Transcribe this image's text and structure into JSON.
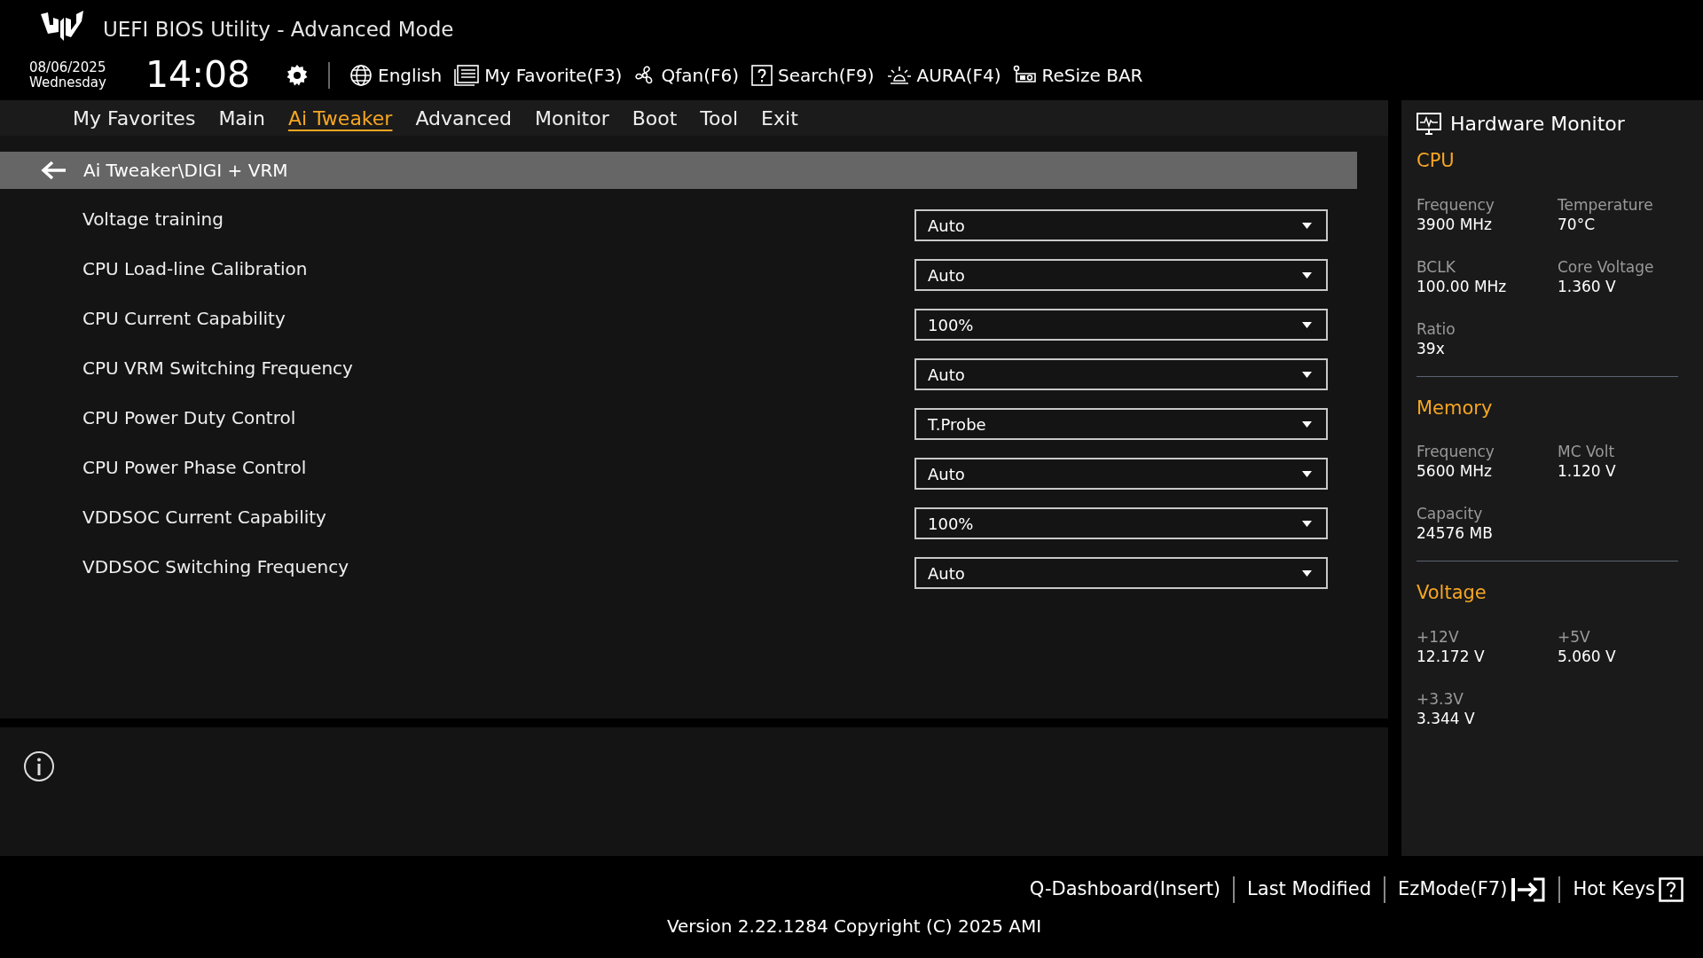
{
  "header": {
    "title": "UEFI BIOS Utility - Advanced Mode",
    "date": "08/06/2025",
    "weekday": "Wednesday",
    "time": "14:08",
    "toolbar": [
      {
        "kind": "settings"
      },
      {
        "kind": "language",
        "label": "English"
      },
      {
        "kind": "favorite",
        "label": "My Favorite(F3)"
      },
      {
        "kind": "fan",
        "label": "Qfan(F6)"
      },
      {
        "kind": "search",
        "label": "Search(F9)"
      },
      {
        "kind": "aura",
        "label": "AURA(F4)"
      },
      {
        "kind": "resize",
        "label": "ReSize BAR"
      }
    ]
  },
  "tabs": [
    {
      "label": "My Favorites",
      "selected": false
    },
    {
      "label": "Main",
      "selected": false
    },
    {
      "label": "Ai Tweaker",
      "selected": true
    },
    {
      "label": "Advanced",
      "selected": false
    },
    {
      "label": "Monitor",
      "selected": false
    },
    {
      "label": "Boot",
      "selected": false
    },
    {
      "label": "Tool",
      "selected": false
    },
    {
      "label": "Exit",
      "selected": false
    }
  ],
  "breadcrumb": "Ai Tweaker\\DIGI + VRM",
  "settings": [
    {
      "label": "Voltage training",
      "value": "Auto"
    },
    {
      "label": "CPU Load-line Calibration",
      "value": "Auto"
    },
    {
      "label": "CPU Current Capability",
      "value": "100%"
    },
    {
      "label": "CPU VRM Switching Frequency",
      "value": "Auto"
    },
    {
      "label": "CPU Power Duty Control",
      "value": "T.Probe"
    },
    {
      "label": "CPU Power Phase Control",
      "value": "Auto"
    },
    {
      "label": "VDDSOC Current Capability",
      "value": "100%"
    },
    {
      "label": "VDDSOC Switching Frequency",
      "value": "Auto"
    }
  ],
  "hardware_monitor": {
    "title": "Hardware Monitor",
    "sections": [
      {
        "title": "CPU",
        "items": [
          {
            "label": "Frequency",
            "value": "3900 MHz"
          },
          {
            "label": "Temperature",
            "value": "70°C"
          },
          {
            "label": "BCLK",
            "value": "100.00 MHz"
          },
          {
            "label": "Core Voltage",
            "value": "1.360 V"
          },
          {
            "label": "Ratio",
            "value": "39x"
          }
        ]
      },
      {
        "title": "Memory",
        "items": [
          {
            "label": "Frequency",
            "value": "5600 MHz"
          },
          {
            "label": "MC Volt",
            "value": "1.120 V"
          },
          {
            "label": "Capacity",
            "value": "24576 MB"
          }
        ]
      },
      {
        "title": "Voltage",
        "items": [
          {
            "label": "+12V",
            "value": "12.172 V"
          },
          {
            "label": "+5V",
            "value": "5.060 V"
          },
          {
            "label": "+3.3V",
            "value": "3.344 V"
          }
        ]
      }
    ]
  },
  "footer": {
    "actions": [
      {
        "kind": "text",
        "label": "Q-Dashboard(Insert)"
      },
      {
        "kind": "text",
        "label": "Last Modified"
      },
      {
        "kind": "ezmode",
        "label": "EzMode(F7)"
      },
      {
        "kind": "hotkeys",
        "label": "Hot Keys"
      }
    ],
    "version": "Version 2.22.1284 Copyright (C) 2025 AMI"
  }
}
